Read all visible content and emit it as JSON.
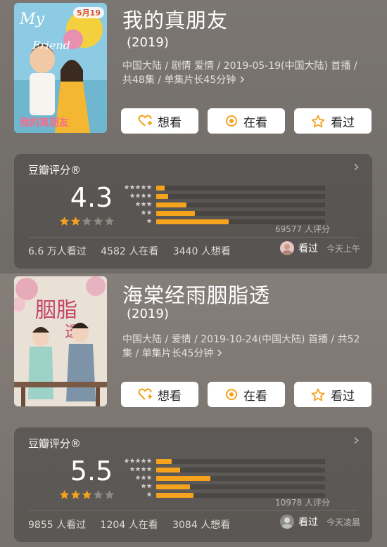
{
  "items": [
    {
      "title": "我的真朋友",
      "year": "(2019)",
      "meta": "中国大陆 / 剧情 爱情 / 2019-05-19(中国大陆) 首播 / 共48集 / 单集片长45分钟",
      "poster_date": "5月19",
      "buttons": {
        "want": "想看",
        "watching": "在看",
        "watched": "看过"
      },
      "rating": {
        "label": "豆瓣评分®",
        "score": "4.3",
        "stars_filled": 2,
        "distribution": [
          0.05,
          0.07,
          0.18,
          0.23,
          0.43
        ],
        "count": "69577 人评分"
      },
      "stats": {
        "watched": "6.6 万人看过",
        "watching": "4582 人在看",
        "want": "3440 人想看"
      },
      "user": {
        "status": "看过",
        "time": "今天上午"
      }
    },
    {
      "title": "海棠经雨胭脂透",
      "year": "(2019)",
      "meta": "中国大陆 / 爱情 / 2019-10-24(中国大陆) 首播 / 共52集 / 单集片长45分钟",
      "poster_date": "",
      "buttons": {
        "want": "想看",
        "watching": "在看",
        "watched": "看过"
      },
      "rating": {
        "label": "豆瓣评分®",
        "score": "5.5",
        "stars_filled": 3,
        "distribution": [
          0.09,
          0.14,
          0.32,
          0.2,
          0.22
        ],
        "count": "10978 人评分"
      },
      "stats": {
        "watched": "9855 人看过",
        "watching": "1204 人在看",
        "want": "3084 人想看"
      },
      "user": {
        "status": "看过",
        "time": "今天凌晨"
      }
    }
  ],
  "colors": {
    "accent": "#f5a21c",
    "star_empty": "#8d8985"
  }
}
